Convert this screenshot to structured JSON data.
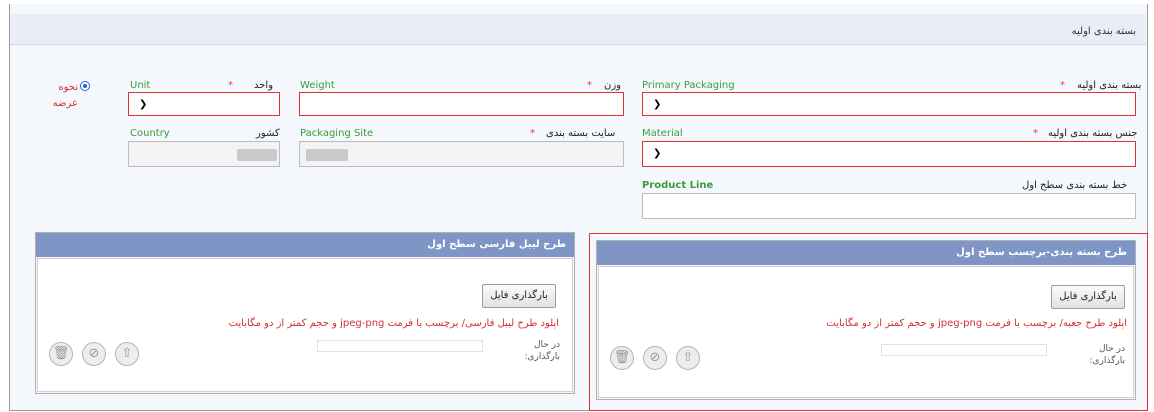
{
  "section": {
    "title": "بسته بندی اولیه"
  },
  "presentation": {
    "label_line1": "نحوه",
    "label_line2": "عرضه"
  },
  "fields": {
    "unit": {
      "en": "Unit",
      "fa": "واحد",
      "req": "*"
    },
    "weight": {
      "en": "Weight",
      "fa": "وزن",
      "req": "*"
    },
    "primary_packaging": {
      "en": "Primary Packaging",
      "fa": "بسته بندی اولیه",
      "req": "*"
    },
    "country": {
      "en": "Country",
      "fa": "کشور"
    },
    "packaging_site": {
      "en": "Packaging Site",
      "fa": "سایت بسته بندی",
      "req": "*"
    },
    "material": {
      "en": "Material",
      "fa": "جنس بسته بندی اولیه",
      "req": "*"
    },
    "product_line": {
      "en": "Product Line",
      "fa": "خط بسته بندی سطح اول"
    }
  },
  "panels": {
    "left": {
      "title": "طرح لیبل فارسی سطح اول",
      "upload_button": "بارگذاری فایل",
      "note": "اپلود طرح لیبل فارسی/ برچسب با فرمت jpeg-png و حجم کمتر از دو مگابایت",
      "status_line1": "در حال",
      "status_line2": "بارگذاری:"
    },
    "right": {
      "title": "طرح بسته بندی-برچسب سطح اول",
      "upload_button": "بارگذاری فایل",
      "note": "اپلود طرح جعبه/ برچسب با فرمت jpeg-png و حجم کمتر از دو مگابایت",
      "status_line1": "در حال",
      "status_line2": "بارگذاری:"
    }
  },
  "icons": {
    "delete": "trash-icon",
    "cancel": "cancel-icon",
    "upload": "upload-icon"
  }
}
